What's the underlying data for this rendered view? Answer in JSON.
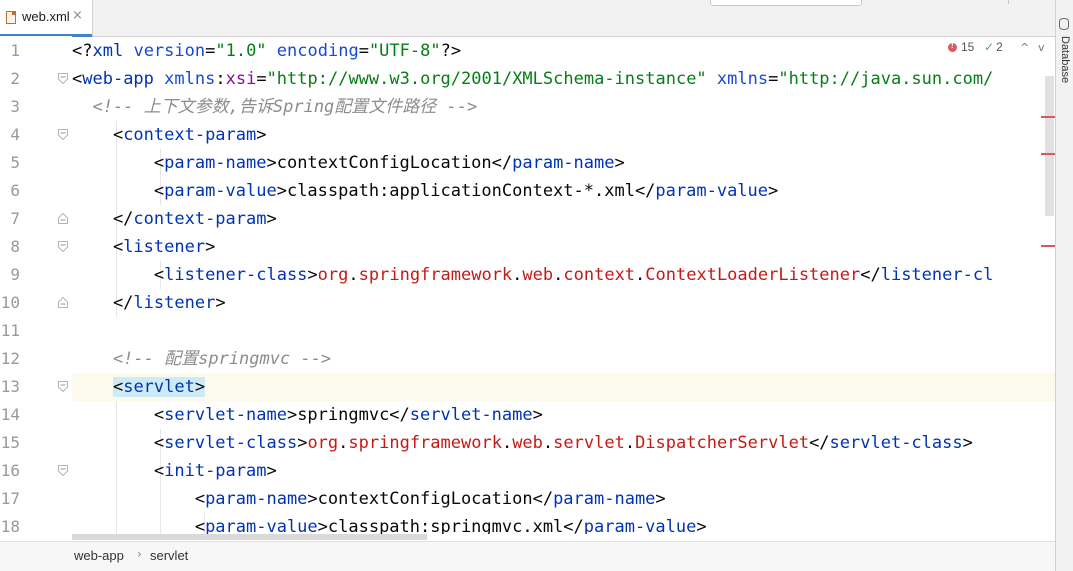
{
  "tab": {
    "label": "web.xml",
    "close": "×"
  },
  "right_panel": {
    "label": "Database"
  },
  "inspections": {
    "errors": "15",
    "checks": "2",
    "up": "^",
    "down": "v",
    "check_glyph": "✓"
  },
  "breadcrumbs": [
    "web-app",
    "servlet"
  ],
  "breadcrumb_sep": "›",
  "current_line": 13,
  "lines": [
    {
      "n": "1",
      "fold": "",
      "tokens": [
        [
          "t-txt",
          "<?"
        ],
        [
          "t-tag",
          "xml"
        ],
        [
          "t-txt",
          " "
        ],
        [
          "t-attr",
          "version"
        ],
        [
          "t-txt",
          "="
        ],
        [
          "t-str",
          "\"1.0\""
        ],
        [
          "t-txt",
          " "
        ],
        [
          "t-attr",
          "encoding"
        ],
        [
          "t-txt",
          "="
        ],
        [
          "t-str",
          "\"UTF-8\""
        ],
        [
          "t-txt",
          "?>"
        ]
      ]
    },
    {
      "n": "2",
      "fold": "open",
      "tokens": [
        [
          "t-txt",
          "<"
        ],
        [
          "t-tag",
          "web-app"
        ],
        [
          "t-txt",
          " "
        ],
        [
          "t-attr",
          "xmlns"
        ],
        [
          "t-txt",
          ":"
        ],
        [
          "t-ns",
          "xsi"
        ],
        [
          "t-txt",
          "="
        ],
        [
          "t-str",
          "\"http://www.w3.org/2001/XMLSchema-instance\""
        ],
        [
          "t-txt",
          " "
        ],
        [
          "t-attr",
          "xmlns"
        ],
        [
          "t-txt",
          "="
        ],
        [
          "t-str",
          "\"http://java.sun.com/"
        ]
      ]
    },
    {
      "n": "3",
      "fold": "",
      "tokens": [
        [
          "t-com",
          "  <!-- 上下文参数,告诉Spring配置文件路径 -->"
        ]
      ]
    },
    {
      "n": "4",
      "fold": "open",
      "tokens": [
        [
          "t-txt",
          "    <"
        ],
        [
          "t-tag",
          "context-param"
        ],
        [
          "t-txt",
          ">"
        ]
      ]
    },
    {
      "n": "5",
      "fold": "",
      "tokens": [
        [
          "t-txt",
          "        <"
        ],
        [
          "t-tag",
          "param-name"
        ],
        [
          "t-txt",
          ">contextConfigLocation</"
        ],
        [
          "t-tag",
          "param-name"
        ],
        [
          "t-txt",
          ">"
        ]
      ]
    },
    {
      "n": "6",
      "fold": "",
      "tokens": [
        [
          "t-txt",
          "        <"
        ],
        [
          "t-tag",
          "param-value"
        ],
        [
          "t-txt",
          ">classpath:applicationContext-*.xml</"
        ],
        [
          "t-tag",
          "param-value"
        ],
        [
          "t-txt",
          ">"
        ]
      ]
    },
    {
      "n": "7",
      "fold": "close",
      "tokens": [
        [
          "t-txt",
          "    </"
        ],
        [
          "t-tag",
          "context-param"
        ],
        [
          "t-txt",
          ">"
        ]
      ]
    },
    {
      "n": "8",
      "fold": "open",
      "tokens": [
        [
          "t-txt",
          "    <"
        ],
        [
          "t-tag",
          "listener"
        ],
        [
          "t-txt",
          ">"
        ]
      ]
    },
    {
      "n": "9",
      "fold": "",
      "tokens": [
        [
          "t-txt",
          "        <"
        ],
        [
          "t-tag",
          "listener-class"
        ],
        [
          "t-txt",
          ">"
        ],
        [
          "t-cls",
          "org"
        ],
        [
          "t-txt",
          "."
        ],
        [
          "t-cls",
          "springframework"
        ],
        [
          "t-txt",
          "."
        ],
        [
          "t-cls",
          "web"
        ],
        [
          "t-txt",
          "."
        ],
        [
          "t-cls",
          "context"
        ],
        [
          "t-txt",
          "."
        ],
        [
          "t-cls",
          "ContextLoaderListener"
        ],
        [
          "t-txt",
          "</"
        ],
        [
          "t-tag",
          "listener-cl"
        ]
      ]
    },
    {
      "n": "10",
      "fold": "close",
      "tokens": [
        [
          "t-txt",
          "    </"
        ],
        [
          "t-tag",
          "listener"
        ],
        [
          "t-txt",
          ">"
        ]
      ]
    },
    {
      "n": "11",
      "fold": "",
      "tokens": []
    },
    {
      "n": "12",
      "fold": "",
      "tokens": [
        [
          "t-com",
          "    <!-- 配置springmvc -->"
        ]
      ]
    },
    {
      "n": "13",
      "fold": "open",
      "tokens": [
        [
          "t-txt",
          "    "
        ],
        [
          "t-txt hl-tag",
          "<"
        ],
        [
          "t-tag hl-tag",
          "servlet"
        ],
        [
          "t-txt hl-tag",
          ">"
        ]
      ]
    },
    {
      "n": "14",
      "fold": "",
      "tokens": [
        [
          "t-txt",
          "        <"
        ],
        [
          "t-tag",
          "servlet-name"
        ],
        [
          "t-txt",
          ">springmvc</"
        ],
        [
          "t-tag",
          "servlet-name"
        ],
        [
          "t-txt",
          ">"
        ]
      ]
    },
    {
      "n": "15",
      "fold": "",
      "tokens": [
        [
          "t-txt",
          "        <"
        ],
        [
          "t-tag",
          "servlet-class"
        ],
        [
          "t-txt",
          ">"
        ],
        [
          "t-cls",
          "org"
        ],
        [
          "t-txt",
          "."
        ],
        [
          "t-cls",
          "springframework"
        ],
        [
          "t-txt",
          "."
        ],
        [
          "t-cls",
          "web"
        ],
        [
          "t-txt",
          "."
        ],
        [
          "t-cls",
          "servlet"
        ],
        [
          "t-txt",
          "."
        ],
        [
          "t-cls",
          "DispatcherServlet"
        ],
        [
          "t-txt",
          "</"
        ],
        [
          "t-tag",
          "servlet-class"
        ],
        [
          "t-txt",
          ">"
        ]
      ]
    },
    {
      "n": "16",
      "fold": "open",
      "tokens": [
        [
          "t-txt",
          "        <"
        ],
        [
          "t-tag",
          "init-param"
        ],
        [
          "t-txt",
          ">"
        ]
      ]
    },
    {
      "n": "17",
      "fold": "",
      "tokens": [
        [
          "t-txt",
          "            <"
        ],
        [
          "t-tag",
          "param-name"
        ],
        [
          "t-txt",
          ">contextConfigLocation</"
        ],
        [
          "t-tag",
          "param-name"
        ],
        [
          "t-txt",
          ">"
        ]
      ]
    },
    {
      "n": "18",
      "fold": "",
      "tokens": [
        [
          "t-txt",
          "            <"
        ],
        [
          "t-tag",
          "param-value"
        ],
        [
          "t-txt",
          ">classpath:springmvc.xml</"
        ],
        [
          "t-tag",
          "param-value"
        ],
        [
          "t-txt",
          ">"
        ]
      ]
    }
  ]
}
